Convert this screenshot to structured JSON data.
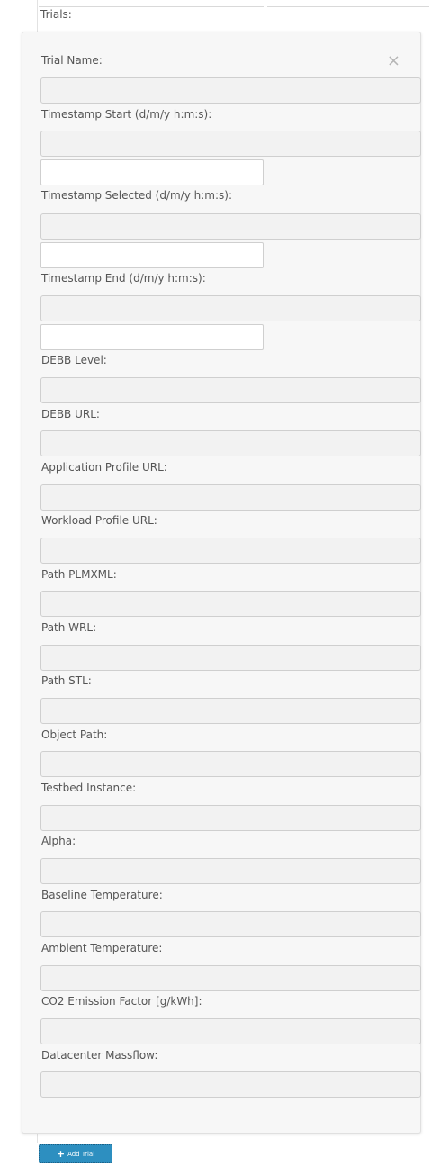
{
  "section": {
    "title": "Trials:"
  },
  "form": {
    "close_icon": "×",
    "fields": {
      "trial_name": {
        "label": "Trial Name:",
        "value": ""
      },
      "timestamp_start": {
        "label": "Timestamp Start (d/m/y h:m:s):",
        "value": "",
        "extra_value": ""
      },
      "timestamp_selected": {
        "label": "Timestamp Selected (d/m/y h:m:s):",
        "value": "",
        "extra_value": ""
      },
      "timestamp_end": {
        "label": "Timestamp End (d/m/y h:m:s):",
        "value": "",
        "extra_value": ""
      },
      "debb_level": {
        "label": "DEBB Level:",
        "value": ""
      },
      "debb_url": {
        "label": "DEBB URL:",
        "value": ""
      },
      "application_profile_url": {
        "label": "Application Profile URL:",
        "value": ""
      },
      "workload_profile_url": {
        "label": "Workload Profile URL:",
        "value": ""
      },
      "path_plmxml": {
        "label": "Path PLMXML:",
        "value": ""
      },
      "path_wrl": {
        "label": "Path WRL:",
        "value": ""
      },
      "path_stl": {
        "label": "Path STL:",
        "value": ""
      },
      "object_path": {
        "label": "Object Path:",
        "value": ""
      },
      "testbed_instance": {
        "label": "Testbed Instance:",
        "value": ""
      },
      "alpha": {
        "label": "Alpha:",
        "value": ""
      },
      "baseline_temperature": {
        "label": "Baseline Temperature:",
        "value": ""
      },
      "ambient_temperature": {
        "label": "Ambient Temperature:",
        "value": ""
      },
      "co2_emission_factor": {
        "label": "CO2 Emission Factor [g/kWh]:",
        "value": ""
      },
      "datacenter_massflow": {
        "label": "Datacenter Massflow:",
        "value": ""
      }
    }
  },
  "actions": {
    "add_trial_icon": "+",
    "add_trial_label": "Add Trial"
  },
  "colors": {
    "button_bg": "#2d8fc0",
    "card_bg": "#f7f7f7",
    "input_bg": "#f2f2f2"
  }
}
